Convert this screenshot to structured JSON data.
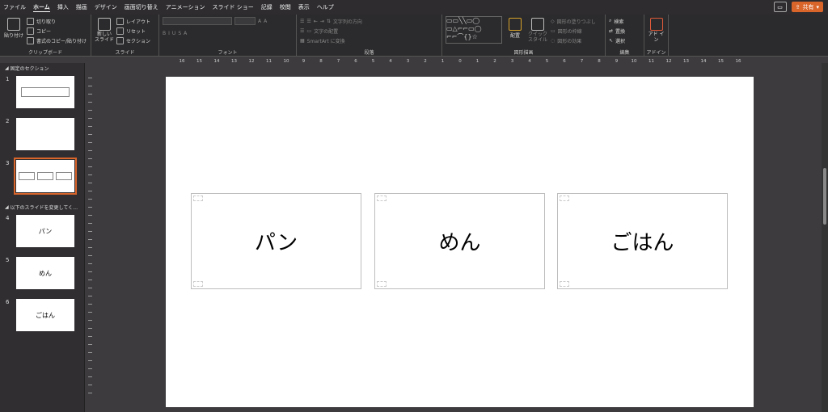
{
  "menu": {
    "tabs": [
      "ファイル",
      "ホーム",
      "挿入",
      "描画",
      "デザイン",
      "画面切り替え",
      "アニメーション",
      "スライド ショー",
      "記録",
      "校閲",
      "表示",
      "ヘルプ"
    ],
    "active_tab": "ホーム",
    "share_label": "共有"
  },
  "ribbon": {
    "clipboard": {
      "paste": "貼り付け",
      "cut": "切り取り",
      "copy": "コピー",
      "format_painter": "書式のコピー/貼り付け",
      "label": "クリップボード"
    },
    "slides": {
      "new_slide": "新しい スライド",
      "layout": "レイアウト",
      "reset": "リセット",
      "section": "セクション",
      "label": "スライド"
    },
    "font": {
      "label": "フォント"
    },
    "paragraph": {
      "text_direction": "文字列の方向",
      "align_text": "文字の配置",
      "smartart": "SmartArt に変換",
      "label": "段落"
    },
    "drawing": {
      "arrange": "配置",
      "quick_styles": "クイック スタイル",
      "shape_fill": "図形の塗りつぶし",
      "shape_outline": "図形の枠線",
      "shape_effects": "図形の効果",
      "label": "図形描画"
    },
    "editing": {
      "find": "検索",
      "replace": "置換",
      "select": "選択",
      "label": "編集"
    },
    "addins": {
      "addin": "アド イン",
      "label": "アドイン"
    }
  },
  "sidebar": {
    "section1": "固定のセクション",
    "section2": "以下のスライドを変更してく…",
    "slides": [
      {
        "num": "1",
        "text": ""
      },
      {
        "num": "2",
        "text": ""
      },
      {
        "num": "3",
        "text": ""
      },
      {
        "num": "4",
        "text": "パン"
      },
      {
        "num": "5",
        "text": "めん"
      },
      {
        "num": "6",
        "text": "ごはん"
      }
    ]
  },
  "ruler": [
    "16",
    "15",
    "14",
    "13",
    "12",
    "11",
    "10",
    "9",
    "8",
    "7",
    "6",
    "5",
    "4",
    "3",
    "2",
    "1",
    "0",
    "1",
    "2",
    "3",
    "4",
    "5",
    "6",
    "7",
    "8",
    "9",
    "10",
    "11",
    "12",
    "13",
    "14",
    "15",
    "16"
  ],
  "slide": {
    "cards": [
      "パン",
      "めん",
      "ごはん"
    ]
  }
}
